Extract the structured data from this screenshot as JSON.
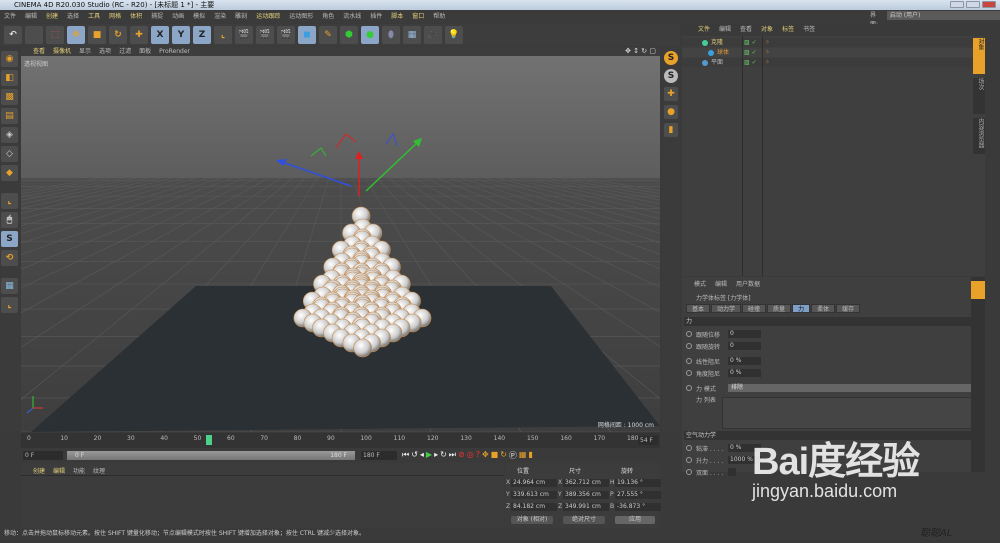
{
  "title": "CINEMA 4D R20.030 Studio (RC - R20) - [未标题 1 *] - 主要",
  "menu": [
    "文件",
    "编辑",
    "创建",
    "选择",
    "工具",
    "网格",
    "体积",
    "捕捉",
    "动画",
    "模拟",
    "渲染",
    "雕刻",
    "运动跟踪",
    "运动图形",
    "角色",
    "流水线",
    "插件",
    "脚本",
    "窗口",
    "帮助"
  ],
  "menu_highlight": [
    2,
    4,
    5,
    6,
    12,
    17,
    18
  ],
  "layout": {
    "label": "界面:",
    "value": "启动 (用户)"
  },
  "toolbar": {
    "axes": [
      "X",
      "Y",
      "Z"
    ]
  },
  "viewport": {
    "menu": [
      "查看",
      "摄像机",
      "显示",
      "选项",
      "过滤",
      "面板",
      "ProRender"
    ],
    "label": "透视视图",
    "grid_info": "网格间距 : 1000 cm"
  },
  "object_manager": {
    "tabs": [
      "文件",
      "编辑",
      "查看",
      "对象",
      "标签",
      "书签"
    ],
    "objects": [
      {
        "name": "克隆",
        "color": "#e3cf7a"
      },
      {
        "name": "球体",
        "color": "#e89a3c"
      },
      {
        "name": "平面",
        "color": "#bbbbbb"
      }
    ],
    "side_tabs": [
      "对象",
      "场次",
      "内容浏览器"
    ]
  },
  "attributes": {
    "menu": [
      "模式",
      "编辑",
      "用户数据"
    ],
    "header": "力学体标签 [力学体]",
    "tabs": [
      "基本",
      "动力学",
      "碰撞",
      "质量",
      "力",
      "柔体",
      "缓存"
    ],
    "active_tab": "力",
    "section": "力",
    "params": [
      {
        "label": "跟随位移",
        "value": "0"
      },
      {
        "label": "跟随旋转",
        "value": "0"
      },
      {
        "label": "线性阻尼",
        "value": "0 %"
      },
      {
        "label": "角度阻尼",
        "value": "0 %"
      }
    ],
    "force_mode_label": "力 模式",
    "force_mode_value": "排除",
    "force_list_label": "力 列表",
    "aero_section": "空气动力学",
    "aero": [
      {
        "label": "粘滞 . . . .",
        "value": "0 %"
      },
      {
        "label": "升力 . . . .",
        "value": "1000 %"
      },
      {
        "label": "双面 . . . .",
        "value": ""
      }
    ]
  },
  "timeline": {
    "ticks": [
      0,
      10,
      20,
      30,
      40,
      50,
      60,
      70,
      80,
      90,
      100,
      110,
      120,
      130,
      140,
      150,
      160,
      170,
      180
    ],
    "current": 54,
    "current_label": "54",
    "end_field": "54 F",
    "start": "0 F",
    "range_start": "0 F",
    "range_end": "180 F",
    "max": "180 F"
  },
  "material": {
    "menu": [
      "创建",
      "编辑",
      "功能",
      "纹理"
    ]
  },
  "coords": {
    "headers": [
      "位置",
      "尺寸",
      "旋转"
    ],
    "rows": [
      {
        "a": "X",
        "pos": "24.964 cm",
        "b": "X",
        "size": "362.712 cm",
        "c": "H",
        "rot": "19.136 °"
      },
      {
        "a": "Y",
        "pos": "339.613 cm",
        "b": "Y",
        "size": "389.356 cm",
        "c": "P",
        "rot": "27.555 °"
      },
      {
        "a": "Z",
        "pos": "84.182 cm",
        "b": "Z",
        "size": "349.991 cm",
        "c": "B",
        "rot": "-36.873 °"
      }
    ],
    "mode": "对象 (相对)",
    "size_mode": "绝对尺寸",
    "apply": "应用"
  },
  "status": "移动：点击并拖动鼠标移动元素。按住 SHIFT 键量化移动；节点编辑模式时按住 SHIFT 键增加选择对象；按住 CTRL 键减少选择对象。",
  "watermark": {
    "logo": "Bai度经验",
    "url": "jingyan.baidu.com"
  },
  "author": "聪聪AL"
}
